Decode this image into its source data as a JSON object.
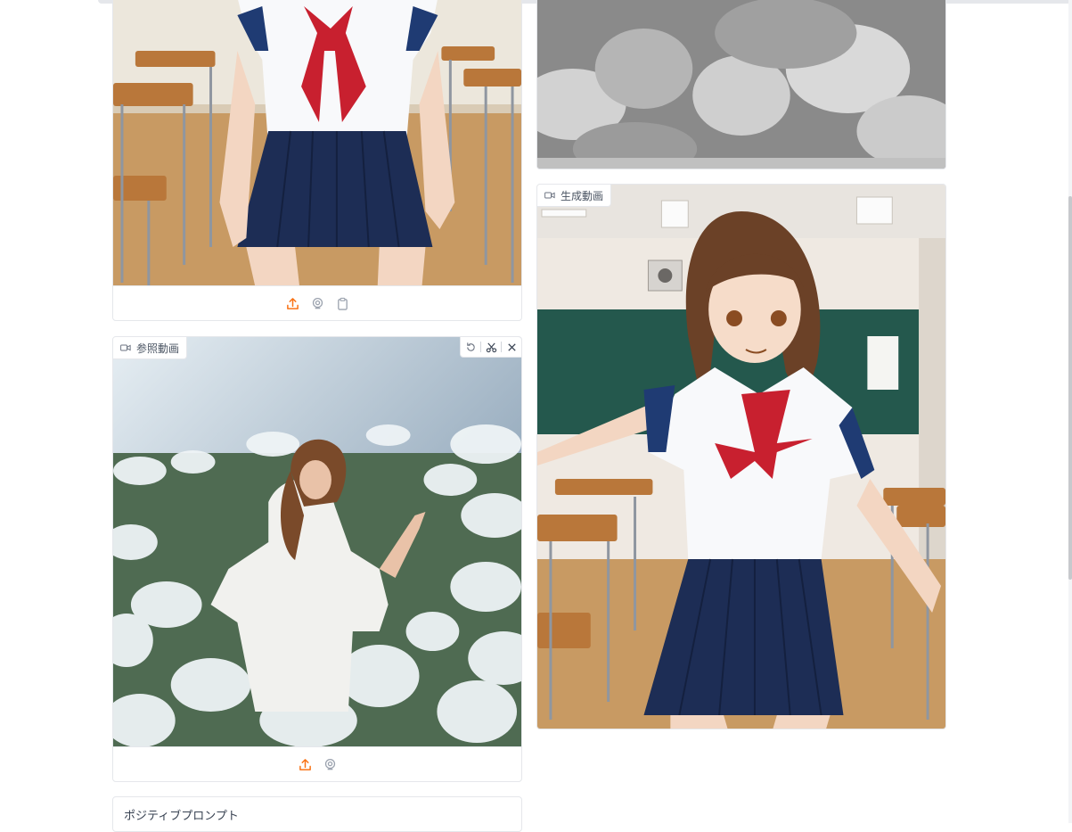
{
  "reference_video": {
    "label": "参照動画"
  },
  "generated_video": {
    "label": "生成動画"
  },
  "prompt": {
    "label": "ポジティブプロンプト"
  },
  "colors": {
    "accent": "#f97316",
    "border": "#e5e7eb",
    "icon_gray": "#9ca3af"
  },
  "icons": {
    "upload": "upload-icon",
    "webcam": "webcam-icon",
    "clipboard": "clipboard-icon",
    "undo": "undo-icon",
    "scissors": "scissors-icon",
    "close": "close-icon",
    "video": "video-camera-icon"
  }
}
